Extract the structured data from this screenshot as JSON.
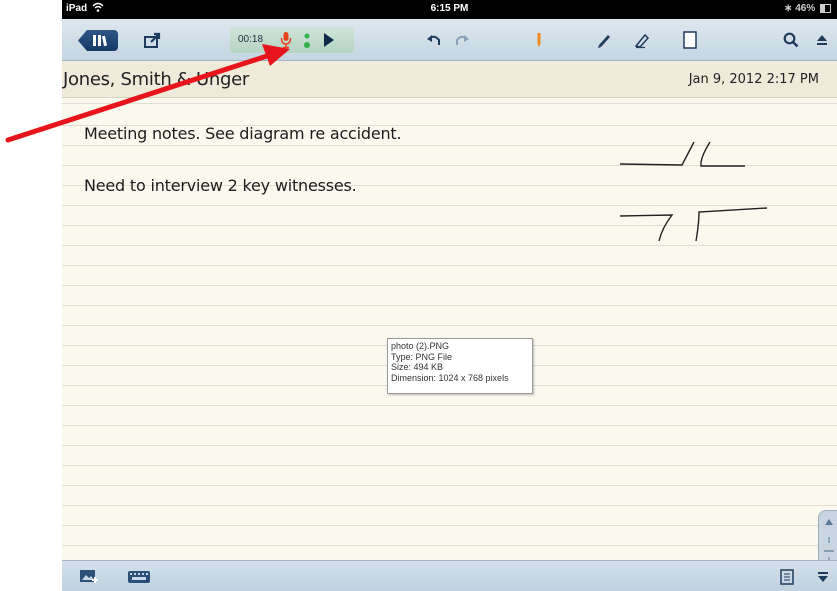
{
  "status_bar": {
    "carrier": "iPad",
    "time": "6:15 PM",
    "battery": "46%"
  },
  "toolbar": {
    "recording_time": "00:18",
    "icons": [
      "library-icon",
      "share-icon",
      "microphone-icon",
      "level-meter-icon",
      "play-icon",
      "undo-icon",
      "redo-icon",
      "pen-color-icon",
      "pen-icon",
      "eraser-icon",
      "page-icon",
      "search-icon",
      "eject-icon"
    ]
  },
  "note": {
    "title": "Jones, Smith & Unger",
    "date": "Jan 9, 2012 2:17 PM",
    "lines": [
      "Meeting notes. See diagram re accident.",
      "Need to interview 2 key witnesses."
    ]
  },
  "tooltip": {
    "name": "photo (2).PNG",
    "type": "Type: PNG File",
    "size": "Size: 494 KB",
    "dimension": "Dimension: 1024 x 768 pixels"
  },
  "colors": {
    "annotation_arrow": "#e8141c",
    "toolbar": "#c9d9e6",
    "paper": "#fbf8ee",
    "library_button": "#1f4677"
  }
}
